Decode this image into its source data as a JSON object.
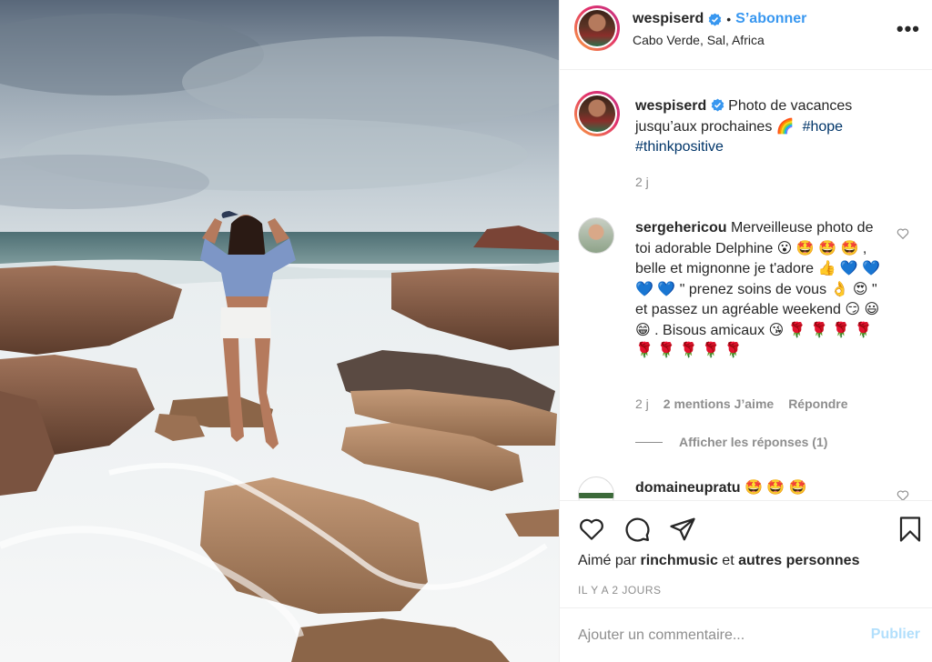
{
  "post": {
    "username": "wespiserd",
    "follow_label": "S’abonner",
    "separator": "•",
    "location": "Cabo Verde, Sal, Africa",
    "more_label": "•••"
  },
  "caption": {
    "username": "wespiserd",
    "text": "Photo de vacances jusqu’aux prochaines 🌈",
    "hashtag1": "#hope",
    "hashtag2": "#thinkpositive",
    "age": "2 j"
  },
  "comments": [
    {
      "username": "sergehericou",
      "text": "Merveilleuse photo de toi adorable Delphine 😮 🤩 🤩 🤩 , belle et mignonne je t'adore 👍 💙 💙 💙 💙  \" prenez soins de vous 👌 😍  \" et passez un agréable weekend 😏 😃 😁  . Bisous amicaux 😘 🌹 🌹 🌹 🌹 🌹 🌹 🌹 🌹 🌹",
      "age": "2 j",
      "likes": "2 mentions J’aime",
      "reply_label": "Répondre",
      "view_replies": "Afficher les réponses (1)"
    },
    {
      "username": "domaineupratu",
      "text": "🤩 🤩 🤩"
    }
  ],
  "footer": {
    "liked_by_prefix": "Aimé par",
    "liked_by_user": "rinchmusic",
    "liked_by_and": "et",
    "liked_by_others": "autres personnes",
    "timestamp": "IL Y A 2 JOURS",
    "comment_placeholder": "Ajouter un commentaire...",
    "publish_label": "Publier"
  },
  "icons": {
    "like": "heart-icon",
    "comment": "comment-icon",
    "share": "share-icon",
    "save": "bookmark-icon",
    "verified": "verified-badge-icon"
  },
  "colors": {
    "link": "#3897f0",
    "hashtag": "#003569",
    "muted": "#8e8e8e",
    "publish_disabled": "#b2dffc"
  }
}
